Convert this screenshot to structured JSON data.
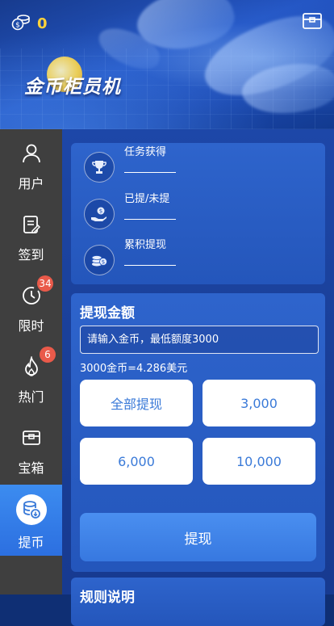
{
  "header": {
    "coin_count": "0",
    "logo_text": "金币柜员机",
    "icons": {
      "coins": "coins-icon",
      "chest": "chest-icon"
    }
  },
  "sidebar": {
    "items": [
      {
        "label": "用户",
        "icon": "user-icon",
        "badge": null,
        "active": false
      },
      {
        "label": "签到",
        "icon": "checkin-icon",
        "badge": null,
        "active": false
      },
      {
        "label": "限时",
        "icon": "timer-icon",
        "badge": "34",
        "active": false
      },
      {
        "label": "热门",
        "icon": "fire-icon",
        "badge": "6",
        "active": false
      },
      {
        "label": "宝箱",
        "icon": "chest-icon",
        "badge": null,
        "active": false
      },
      {
        "label": "提币",
        "icon": "withdraw-coins-icon",
        "badge": null,
        "active": true
      }
    ]
  },
  "stats": {
    "items": [
      {
        "label": "任务获得",
        "icon": "trophy-icon"
      },
      {
        "label": "已提/未提",
        "icon": "hand-coin-icon"
      },
      {
        "label": "累积提现",
        "icon": "coin-stack-icon"
      }
    ]
  },
  "withdraw": {
    "title": "提现金额",
    "placeholder": "请输入金币，最低额度3000",
    "rate_text": "3000金币=4.286美元",
    "amounts": [
      "全部提现",
      "3,000",
      "6,000",
      "10,000"
    ],
    "submit_label": "提现"
  },
  "rules": {
    "title": "规则说明"
  },
  "colors": {
    "accent": "#3a7ad8",
    "sidebar_bg": "#3f3f3f",
    "active_bg": "#2c6fe0",
    "badge": "#e95a4a",
    "coin_yellow": "#ffd23a"
  }
}
